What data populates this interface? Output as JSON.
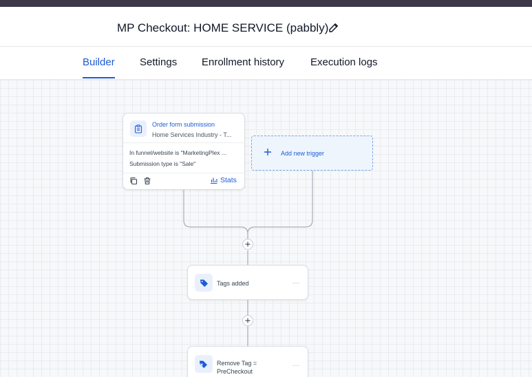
{
  "header": {
    "title": "MP Checkout: HOME SERVICE (pabbly)",
    "edit_icon": "pencil-icon"
  },
  "tabs": [
    {
      "label": "Builder",
      "active": true
    },
    {
      "label": "Settings",
      "active": false
    },
    {
      "label": "Enrollment history",
      "active": false
    },
    {
      "label": "Execution logs",
      "active": false
    }
  ],
  "trigger": {
    "icon": "clipboard-icon",
    "title": "Order form submission",
    "subtitle": "Home Services Industry - T...",
    "conditions": [
      "In funnel/website is \"MarketingPlex ...",
      "Submission type is \"Sale\""
    ],
    "stats_label": "Stats"
  },
  "add_trigger": {
    "label": "Add new trigger"
  },
  "actions": [
    {
      "icon": "tag-icon",
      "label_line1": "Tags added",
      "label_line2": ""
    },
    {
      "icon": "remove-tag-icon",
      "label_line1": "Remove Tag =",
      "label_line2": "PreCheckout"
    }
  ],
  "colors": {
    "accent": "#1d5bd6",
    "topbar": "#3d3748",
    "canvas_bg": "#f7f8fa",
    "add_trigger_bg": "#eef5fd"
  }
}
